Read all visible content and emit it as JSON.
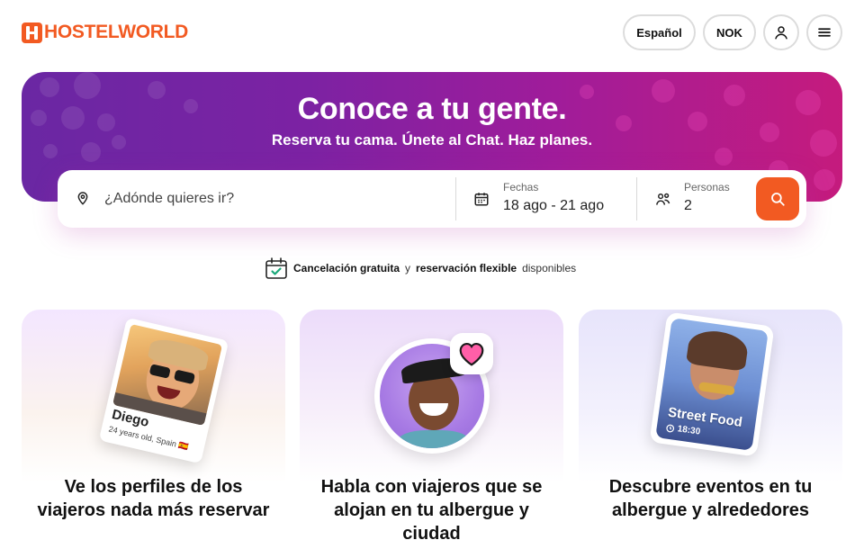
{
  "brand": {
    "name": "HOSTELWORLD",
    "color": "#f25a22"
  },
  "header": {
    "language_label": "Español",
    "currency_label": "NOK",
    "user_icon": "user-icon",
    "menu_icon": "menu-icon"
  },
  "hero": {
    "title": "Conoce a tu gente.",
    "subtitle": "Reserva tu cama. Únete al Chat. Haz planes."
  },
  "search": {
    "destination_placeholder": "¿Adónde quieres ir?",
    "dates_label": "Fechas",
    "dates_value": "18 ago - 21 ago",
    "guests_label": "Personas",
    "guests_value": "2",
    "search_button_icon": "search-icon"
  },
  "cancellation_note": {
    "part1": "Cancelación gratuita",
    "connector": "y",
    "part2": "reservación flexible",
    "suffix": "disponibles"
  },
  "cards": [
    {
      "title": "Ve los perfiles de los viajeros nada más reservar",
      "profile_name": "Diego",
      "profile_meta": "24 years old, Spain 🇪🇸"
    },
    {
      "title": "Habla con viajeros que se alojan en tu albergue y ciudad",
      "badge_icon": "heart-icon"
    },
    {
      "title": "Descubre eventos en tu albergue y alrededores",
      "event_name": "Street Food",
      "event_time": "18:30"
    }
  ]
}
